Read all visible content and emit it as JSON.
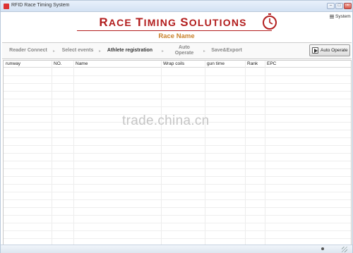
{
  "window": {
    "title": "RFID Race Timing System"
  },
  "system_menu": {
    "label": "System"
  },
  "brand": {
    "logo_text": "Race Timing Solutions",
    "logo_color": "#b21d1d"
  },
  "race": {
    "name": "Race Name",
    "color": "#c9802a"
  },
  "nav": {
    "steps": [
      {
        "label": "Reader Connect"
      },
      {
        "label": "Select events"
      },
      {
        "label": "Athlete registration"
      },
      {
        "label": "Auto Operate"
      },
      {
        "label": "Save&Export"
      }
    ],
    "auto_button_label": "Auto Operate"
  },
  "table": {
    "columns": [
      "runway",
      "NO.",
      "Name",
      "Wrap coils",
      "gun time",
      "Rank",
      "EPC"
    ],
    "rows": []
  },
  "watermark": "trade.china.cn"
}
